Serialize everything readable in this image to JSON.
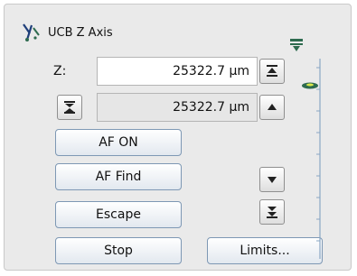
{
  "panel": {
    "title": "UCB Z Axis"
  },
  "z_control": {
    "label": "Z:",
    "value": "25322.7 µm",
    "readout": "25322.7 µm"
  },
  "buttons": {
    "af_on": "AF ON",
    "af_find": "AF Find",
    "escape": "Escape",
    "stop": "Stop",
    "limits": "Limits..."
  },
  "icons": {
    "title": "microscope-axis-icon",
    "top_marker": "top-limit-marker-icon",
    "position_marker": "current-position-marker-icon"
  },
  "colors": {
    "button_border": "#7e98b4",
    "marker": "#2e6b4f"
  }
}
